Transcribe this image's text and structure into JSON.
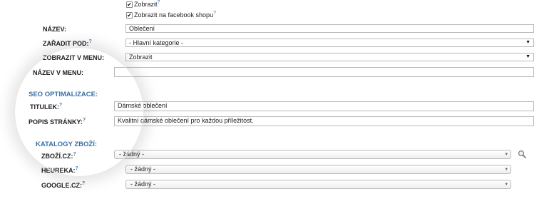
{
  "checkboxes": [
    {
      "label": "Zobrazit",
      "checked": true,
      "help": "?"
    },
    {
      "label": "Zobrazit na facebook shopu",
      "checked": true,
      "help": "?"
    }
  ],
  "fields": {
    "nazev": {
      "label": "NÁZEV:",
      "value": "Oblečení"
    },
    "zaradit": {
      "label": "ZAŘADIT POD:",
      "help": "?",
      "value": "- Hlavní kategorie -"
    },
    "zobrazit_menu": {
      "label": "ZOBRAZIT V MENU:",
      "value": "Zobrazit"
    },
    "nazev_menu": {
      "label": "NÁZEV V MENU:",
      "value": ""
    }
  },
  "seo": {
    "heading": "SEO OPTIMALIZACE:",
    "titulek": {
      "label": "TITULEK:",
      "help": "?",
      "value": "Dámské oblečení"
    },
    "popis": {
      "label": "POPIS STRÁNKY:",
      "help": "?",
      "value": "Kvalitní dámské oblečení pro každou příležitost."
    }
  },
  "katalogy": {
    "heading": "KATALOGY ZBOŽÍ:",
    "items": [
      {
        "label": "ZBOŽÍ.CZ:",
        "help": "?",
        "value": "- žádný -"
      },
      {
        "label": "HEUREKA:",
        "help": "?",
        "value": "- žádný -"
      },
      {
        "label": "GOOGLE.CZ:",
        "help": "?",
        "value": "- žádný -"
      }
    ]
  },
  "icons": {
    "checkbox_mark": "✔",
    "dropdown_arrow": "▼",
    "combo_arrow": "▾",
    "search": "search-icon"
  },
  "colors": {
    "section": "#3a70a6",
    "help": "#4a7fb5",
    "border": "#b9b9b9"
  }
}
